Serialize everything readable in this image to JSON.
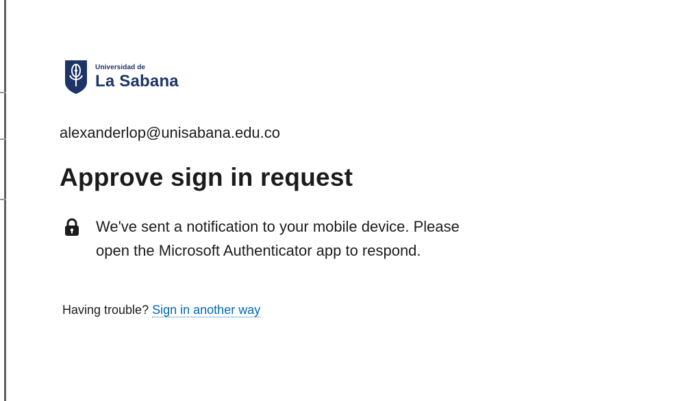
{
  "logo": {
    "line1": "Universidad de",
    "line2": "La Sabana",
    "brand_color": "#1e3466"
  },
  "account": {
    "email": "alexanderlop@unisabana.edu.co"
  },
  "heading": {
    "title": "Approve sign in request"
  },
  "notice": {
    "icon": "lock-icon",
    "text": "We've sent a notification to your mobile device. Please open the Microsoft Authenticator app to respond."
  },
  "help": {
    "prompt": "Having trouble?",
    "link_label": "Sign in another way",
    "link_color": "#0067b8"
  }
}
